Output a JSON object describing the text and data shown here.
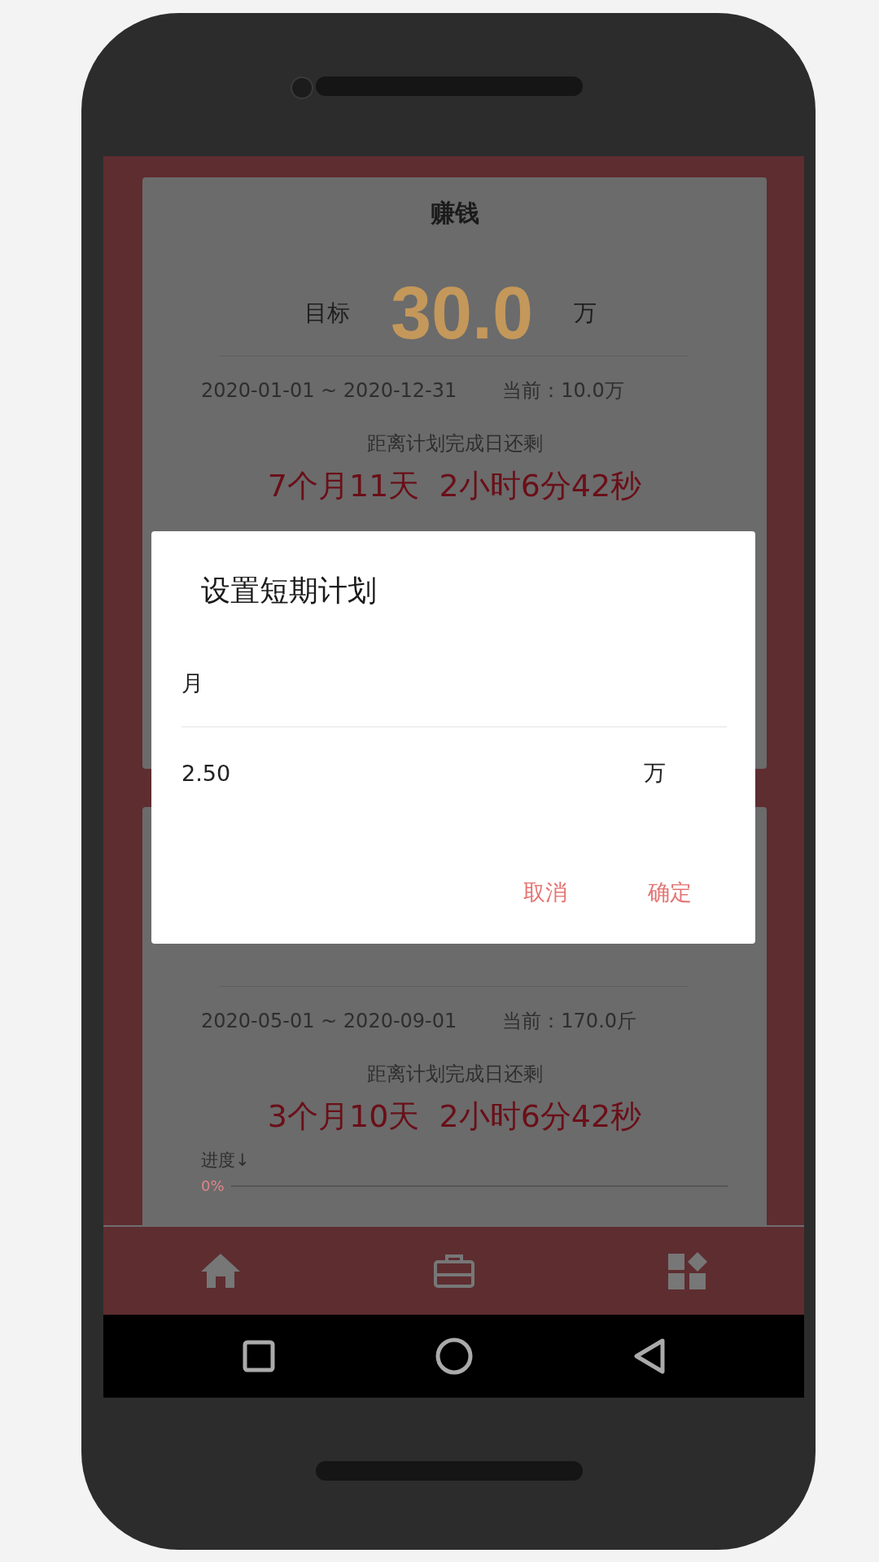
{
  "plans": [
    {
      "title": "赚钱",
      "target_label": "目标",
      "target_value": "30.0",
      "target_unit": "万",
      "date_range": "2020-01-01 ~ 2020-12-31",
      "current": "当前：10.0万",
      "remaining_label": "距离计划完成日还剩",
      "countdown": "7个月11天  2小时6分42秒"
    },
    {
      "date_range": "2020-05-01 ~ 2020-09-01",
      "current": "当前：170.0斤",
      "remaining_label": "距离计划完成日还剩",
      "countdown": "3个月10天  2小时6分42秒",
      "progress_label": "进度↓",
      "progress_text": "0%",
      "level": 0
    }
  ],
  "dialog": {
    "title": "设置短期计划",
    "period": "月",
    "amount": "2.50",
    "unit": "万",
    "buttons": [
      "取消",
      "确定"
    ]
  }
}
